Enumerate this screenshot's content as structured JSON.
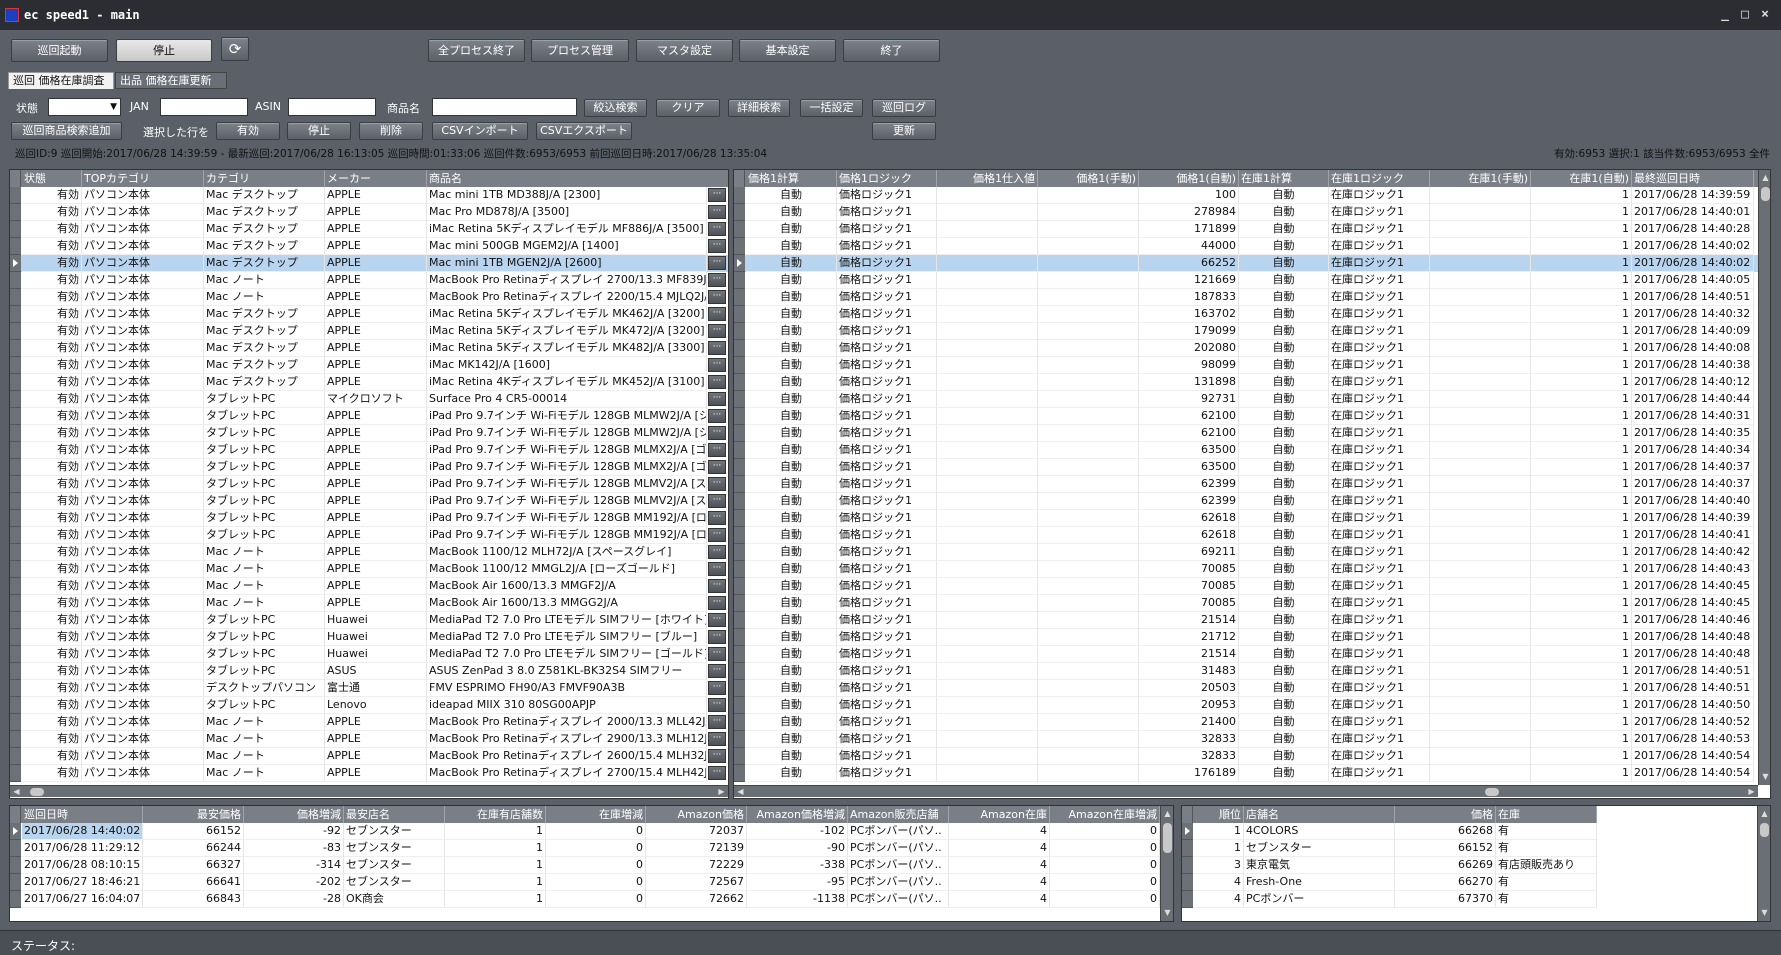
{
  "window": {
    "title": "ec speed1 - main",
    "min": "_",
    "max": "□",
    "close": "×"
  },
  "toolbar": {
    "start": "巡回起動",
    "stop": "停止",
    "refresh_icon": "refresh-icon",
    "kill_all": "全プロセス終了",
    "process_mgmt": "プロセス管理",
    "master": "マスタ設定",
    "basic": "基本設定",
    "exit": "終了"
  },
  "tabs": [
    {
      "label": "巡回 価格在庫調査"
    },
    {
      "label": "出品 価格在庫更新"
    }
  ],
  "filters": {
    "status_label": "状態",
    "status_value": "",
    "jan_label": "JAN",
    "jan_value": "",
    "asin_label": "ASIN",
    "asin_value": "",
    "name_label": "商品名",
    "name_value": "",
    "search": "絞込検索",
    "clear": "クリア",
    "advanced": "詳細検索",
    "bulk": "一括設定",
    "log": "巡回ログ"
  },
  "actions": {
    "add": "巡回商品検索追加",
    "selected_rows_label": "選択した行を",
    "enable": "有効",
    "stop": "停止",
    "delete": "削除",
    "csv_import": "CSVインポート",
    "csv_export": "CSVエクスポート",
    "update": "更新"
  },
  "info": {
    "left": "巡回ID:9 巡回開始:2017/06/28 14:39:59 - 最新巡回:2017/06/28 16:13:05 巡回時間:01:33:06 巡回件数:6953/6953 前回巡回日時:2017/06/28 13:35:04",
    "right": "有効:6953 選択:1 該当件数:6953/6953 全件"
  },
  "left_grid": {
    "columns": [
      "状態",
      "TOPカテゴリ",
      "カテゴリ",
      "メーカー",
      "商品名"
    ],
    "rows": [
      [
        "有効",
        "パソコン本体",
        "Mac デスクトップ",
        "APPLE",
        "Mac mini 1TB MD388J/A [2300]"
      ],
      [
        "有効",
        "パソコン本体",
        "Mac デスクトップ",
        "APPLE",
        "Mac Pro MD878J/A [3500]"
      ],
      [
        "有効",
        "パソコン本体",
        "Mac デスクトップ",
        "APPLE",
        "iMac Retina 5Kディスプレイモデル MF886J/A [3500]"
      ],
      [
        "有効",
        "パソコン本体",
        "Mac デスクトップ",
        "APPLE",
        "Mac mini 500GB MGEM2J/A [1400]"
      ],
      [
        "有効",
        "パソコン本体",
        "Mac デスクトップ",
        "APPLE",
        "Mac mini 1TB MGEN2J/A [2600]"
      ],
      [
        "有効",
        "パソコン本体",
        "Mac ノート",
        "APPLE",
        "MacBook Pro Retinaディスプレイ 2700/13.3 MF839J/A"
      ],
      [
        "有効",
        "パソコン本体",
        "Mac ノート",
        "APPLE",
        "MacBook Pro Retinaディスプレイ 2200/15.4 MJLQ2J/A"
      ],
      [
        "有効",
        "パソコン本体",
        "Mac デスクトップ",
        "APPLE",
        "iMac Retina 5Kディスプレイモデル MK462J/A [3200]"
      ],
      [
        "有効",
        "パソコン本体",
        "Mac デスクトップ",
        "APPLE",
        "iMac Retina 5Kディスプレイモデル MK472J/A [3200]"
      ],
      [
        "有効",
        "パソコン本体",
        "Mac デスクトップ",
        "APPLE",
        "iMac Retina 5Kディスプレイモデル MK482J/A [3300]"
      ],
      [
        "有効",
        "パソコン本体",
        "Mac デスクトップ",
        "APPLE",
        "iMac MK142J/A [1600]"
      ],
      [
        "有効",
        "パソコン本体",
        "Mac デスクトップ",
        "APPLE",
        "iMac Retina 4Kディスプレイモデル MK452J/A [3100]"
      ],
      [
        "有効",
        "パソコン本体",
        "タブレットPC",
        "マイクロソフト",
        "Surface Pro 4 CR5-00014"
      ],
      [
        "有効",
        "パソコン本体",
        "タブレットPC",
        "APPLE",
        "iPad Pro 9.7インチ Wi-Fiモデル 128GB MLMW2J/A [シ"
      ],
      [
        "有効",
        "パソコン本体",
        "タブレットPC",
        "APPLE",
        "iPad Pro 9.7インチ Wi-Fiモデル 128GB MLMW2J/A [シ"
      ],
      [
        "有効",
        "パソコン本体",
        "タブレットPC",
        "APPLE",
        "iPad Pro 9.7インチ Wi-Fiモデル 128GB MLMX2J/A [ゴ"
      ],
      [
        "有効",
        "パソコン本体",
        "タブレットPC",
        "APPLE",
        "iPad Pro 9.7インチ Wi-Fiモデル 128GB MLMX2J/A [ゴ"
      ],
      [
        "有効",
        "パソコン本体",
        "タブレットPC",
        "APPLE",
        "iPad Pro 9.7インチ Wi-Fiモデル 128GB MLMV2J/A [ス"
      ],
      [
        "有効",
        "パソコン本体",
        "タブレットPC",
        "APPLE",
        "iPad Pro 9.7インチ Wi-Fiモデル 128GB MLMV2J/A [ス"
      ],
      [
        "有効",
        "パソコン本体",
        "タブレットPC",
        "APPLE",
        "iPad Pro 9.7インチ Wi-Fiモデル 128GB MM192J/A [ロ"
      ],
      [
        "有効",
        "パソコン本体",
        "タブレットPC",
        "APPLE",
        "iPad Pro 9.7インチ Wi-Fiモデル 128GB MM192J/A [ロ"
      ],
      [
        "有効",
        "パソコン本体",
        "Mac ノート",
        "APPLE",
        "MacBook 1100/12 MLH72J/A [スペースグレイ]"
      ],
      [
        "有効",
        "パソコン本体",
        "Mac ノート",
        "APPLE",
        "MacBook 1100/12 MMGL2J/A [ローズゴールド]"
      ],
      [
        "有効",
        "パソコン本体",
        "Mac ノート",
        "APPLE",
        "MacBook Air 1600/13.3 MMGF2J/A"
      ],
      [
        "有効",
        "パソコン本体",
        "Mac ノート",
        "APPLE",
        "MacBook Air 1600/13.3 MMGG2J/A"
      ],
      [
        "有効",
        "パソコン本体",
        "タブレットPC",
        "Huawei",
        "MediaPad T2 7.0 Pro LTEモデル SIMフリー [ホワイト]"
      ],
      [
        "有効",
        "パソコン本体",
        "タブレットPC",
        "Huawei",
        "MediaPad T2 7.0 Pro LTEモデル SIMフリー [ブルー]"
      ],
      [
        "有効",
        "パソコン本体",
        "タブレットPC",
        "Huawei",
        "MediaPad T2 7.0 Pro LTEモデル SIMフリー [ゴールド]"
      ],
      [
        "有効",
        "パソコン本体",
        "タブレットPC",
        "ASUS",
        "ASUS ZenPad 3 8.0 Z581KL-BK32S4 SIMフリー"
      ],
      [
        "有効",
        "パソコン本体",
        "デスクトップパソコン",
        "富士通",
        "FMV ESPRIMO FH90/A3 FMVF90A3B"
      ],
      [
        "有効",
        "パソコン本体",
        "タブレットPC",
        "Lenovo",
        "ideapad MIIX 310 80SG00APJP"
      ],
      [
        "有効",
        "パソコン本体",
        "Mac ノート",
        "APPLE",
        "MacBook Pro Retinaディスプレイ 2000/13.3 MLL42J/A"
      ],
      [
        "有効",
        "パソコン本体",
        "Mac ノート",
        "APPLE",
        "MacBook Pro Retinaディスプレイ 2900/13.3 MLH12J/A"
      ],
      [
        "有効",
        "パソコン本体",
        "Mac ノート",
        "APPLE",
        "MacBook Pro Retinaディスプレイ 2600/15.4 MLH32J/A"
      ],
      [
        "有効",
        "パソコン本体",
        "Mac ノート",
        "APPLE",
        "MacBook Pro Retinaディスプレイ 2700/15.4 MLH42J/A"
      ]
    ],
    "selected_index": 4,
    "dots": "···"
  },
  "right_grid": {
    "columns": [
      "価格1計算",
      "価格1ロジック",
      "価格1仕入値",
      "価格1(手動)",
      "価格1(自動)",
      "在庫1計算",
      "在庫1ロジック",
      "在庫1(手動)",
      "在庫1(自動)",
      "最終巡回日時",
      "・"
    ],
    "calc": "自動",
    "price_logic": "価格ロジック1",
    "stock_logic": "在庫ロジック1",
    "stock_auto": "1",
    "rows": [
      [
        "100",
        "2017/06/28 14:39:59"
      ],
      [
        "278984",
        "2017/06/28 14:40:01"
      ],
      [
        "171899",
        "2017/06/28 14:40:28"
      ],
      [
        "44000",
        "2017/06/28 14:40:02"
      ],
      [
        "66252",
        "2017/06/28 14:40:02"
      ],
      [
        "121669",
        "2017/06/28 14:40:05"
      ],
      [
        "187833",
        "2017/06/28 14:40:51"
      ],
      [
        "163702",
        "2017/06/28 14:40:32"
      ],
      [
        "179099",
        "2017/06/28 14:40:09"
      ],
      [
        "202080",
        "2017/06/28 14:40:08"
      ],
      [
        "98099",
        "2017/06/28 14:40:38"
      ],
      [
        "131898",
        "2017/06/28 14:40:12"
      ],
      [
        "92731",
        "2017/06/28 14:40:44"
      ],
      [
        "62100",
        "2017/06/28 14:40:31"
      ],
      [
        "62100",
        "2017/06/28 14:40:35"
      ],
      [
        "63500",
        "2017/06/28 14:40:34"
      ],
      [
        "63500",
        "2017/06/28 14:40:37"
      ],
      [
        "62399",
        "2017/06/28 14:40:37"
      ],
      [
        "62399",
        "2017/06/28 14:40:40"
      ],
      [
        "62618",
        "2017/06/28 14:40:39"
      ],
      [
        "62618",
        "2017/06/28 14:40:41"
      ],
      [
        "69211",
        "2017/06/28 14:40:42"
      ],
      [
        "70085",
        "2017/06/28 14:40:43"
      ],
      [
        "70085",
        "2017/06/28 14:40:45"
      ],
      [
        "70085",
        "2017/06/28 14:40:45"
      ],
      [
        "21514",
        "2017/06/28 14:40:46"
      ],
      [
        "21712",
        "2017/06/28 14:40:48"
      ],
      [
        "21514",
        "2017/06/28 14:40:48"
      ],
      [
        "31483",
        "2017/06/28 14:40:51"
      ],
      [
        "20503",
        "2017/06/28 14:40:51"
      ],
      [
        "20953",
        "2017/06/28 14:40:50"
      ],
      [
        "21400",
        "2017/06/28 14:40:52"
      ],
      [
        "32833",
        "2017/06/28 14:40:53"
      ],
      [
        "32833",
        "2017/06/28 14:40:54"
      ],
      [
        "176189",
        "2017/06/28 14:40:54"
      ]
    ]
  },
  "history_grid": {
    "columns": [
      "巡回日時",
      "最安価格",
      "価格増減",
      "最安店名",
      "在庫有店舗数",
      "在庫増減",
      "Amazon価格",
      "Amazon価格増減",
      "Amazon販売店舗",
      "Amazon在庫",
      "Amazon在庫増減"
    ],
    "rows": [
      [
        "2017/06/28 14:40:02",
        "66152",
        "-92",
        "セブンスター",
        "1",
        "0",
        "72037",
        "-102",
        "PCボンバー(パソ..",
        "4",
        "0"
      ],
      [
        "2017/06/28 11:29:12",
        "66244",
        "-83",
        "セブンスター",
        "1",
        "0",
        "72139",
        "-90",
        "PCボンバー(パソ..",
        "4",
        "0"
      ],
      [
        "2017/06/28 08:10:15",
        "66327",
        "-314",
        "セブンスター",
        "1",
        "0",
        "72229",
        "-338",
        "PCボンバー(パソ..",
        "4",
        "0"
      ],
      [
        "2017/06/27 18:46:21",
        "66641",
        "-202",
        "セブンスター",
        "1",
        "0",
        "72567",
        "-95",
        "PCボンバー(パソ..",
        "4",
        "0"
      ],
      [
        "2017/06/27 16:04:07",
        "66843",
        "-28",
        "OK商会",
        "1",
        "0",
        "72662",
        "-1138",
        "PCボンバー(パソ..",
        "4",
        "0"
      ]
    ]
  },
  "shop_grid": {
    "columns": [
      "順位",
      "店舗名",
      "価格",
      "在庫"
    ],
    "rows": [
      [
        "1",
        "4COLORS",
        "66268",
        "有"
      ],
      [
        "1",
        "セブンスター",
        "66152",
        "有"
      ],
      [
        "3",
        "東京電気",
        "66269",
        "有店頭販売あり"
      ],
      [
        "4",
        "Fresh-One",
        "66270",
        "有"
      ],
      [
        "4",
        "PCボンバー",
        "67370",
        "有"
      ]
    ]
  },
  "status": {
    "label": "ステータス:"
  }
}
